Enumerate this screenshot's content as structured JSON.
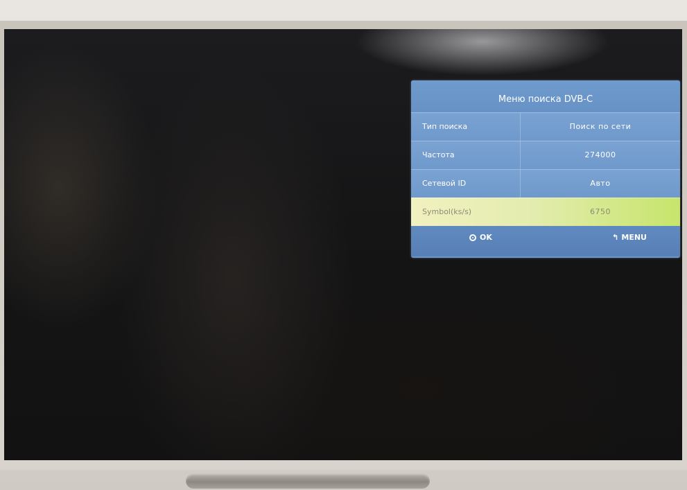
{
  "menu": {
    "title": "Меню поиска DVB-C",
    "rows": [
      {
        "label": "Тип поиска",
        "value": "Поиск по сети"
      },
      {
        "label": "Частота",
        "value": "274000"
      },
      {
        "label": "Сетевой ID",
        "value": "Авто"
      },
      {
        "label": "Symbol(ks/s)",
        "value": "6750"
      }
    ],
    "selected_index": 3,
    "footer": {
      "ok_label": "OK",
      "ok_icon": "ok-circle-icon",
      "menu_label": "MENU",
      "menu_icon": "return-arrow-icon"
    }
  },
  "colors": {
    "menu_blue": "#6a95c8",
    "selected_row": "#d9ea9a"
  }
}
